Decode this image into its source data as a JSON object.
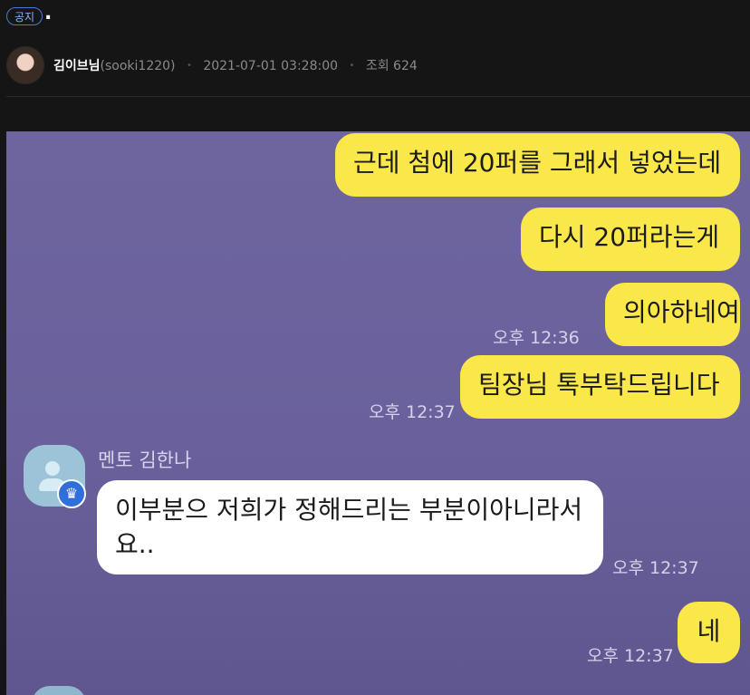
{
  "post": {
    "badge": "공지",
    "title": ".",
    "author": "김이브님",
    "author_id": "(sooki1220)",
    "datetime": "2021-07-01 03:28:00",
    "views": "조회 624"
  },
  "chat": {
    "messages_out": [
      {
        "text": "근데 첨에 20퍼를 그래서 넣었는데"
      },
      {
        "text": "다시 20퍼라는게"
      },
      {
        "text": "의아하네여"
      },
      {
        "text": "팀장님 톡부탁드립니다"
      },
      {
        "text": "네"
      }
    ],
    "times": [
      "오후 12:36",
      "오후 12:37",
      "오후 12:37",
      "오후 12:37"
    ],
    "sender_name": "멘토 김한나",
    "message_in": "이부분으 저희가 정해드리는 부분이아니라서요.."
  },
  "colors": {
    "outgoing_bubble": "#fae84a",
    "chat_background": "#6a619c",
    "incoming_bubble": "#ffffff"
  },
  "icons": {
    "crown": "crown-icon",
    "avatar": "default-profile-icon"
  }
}
